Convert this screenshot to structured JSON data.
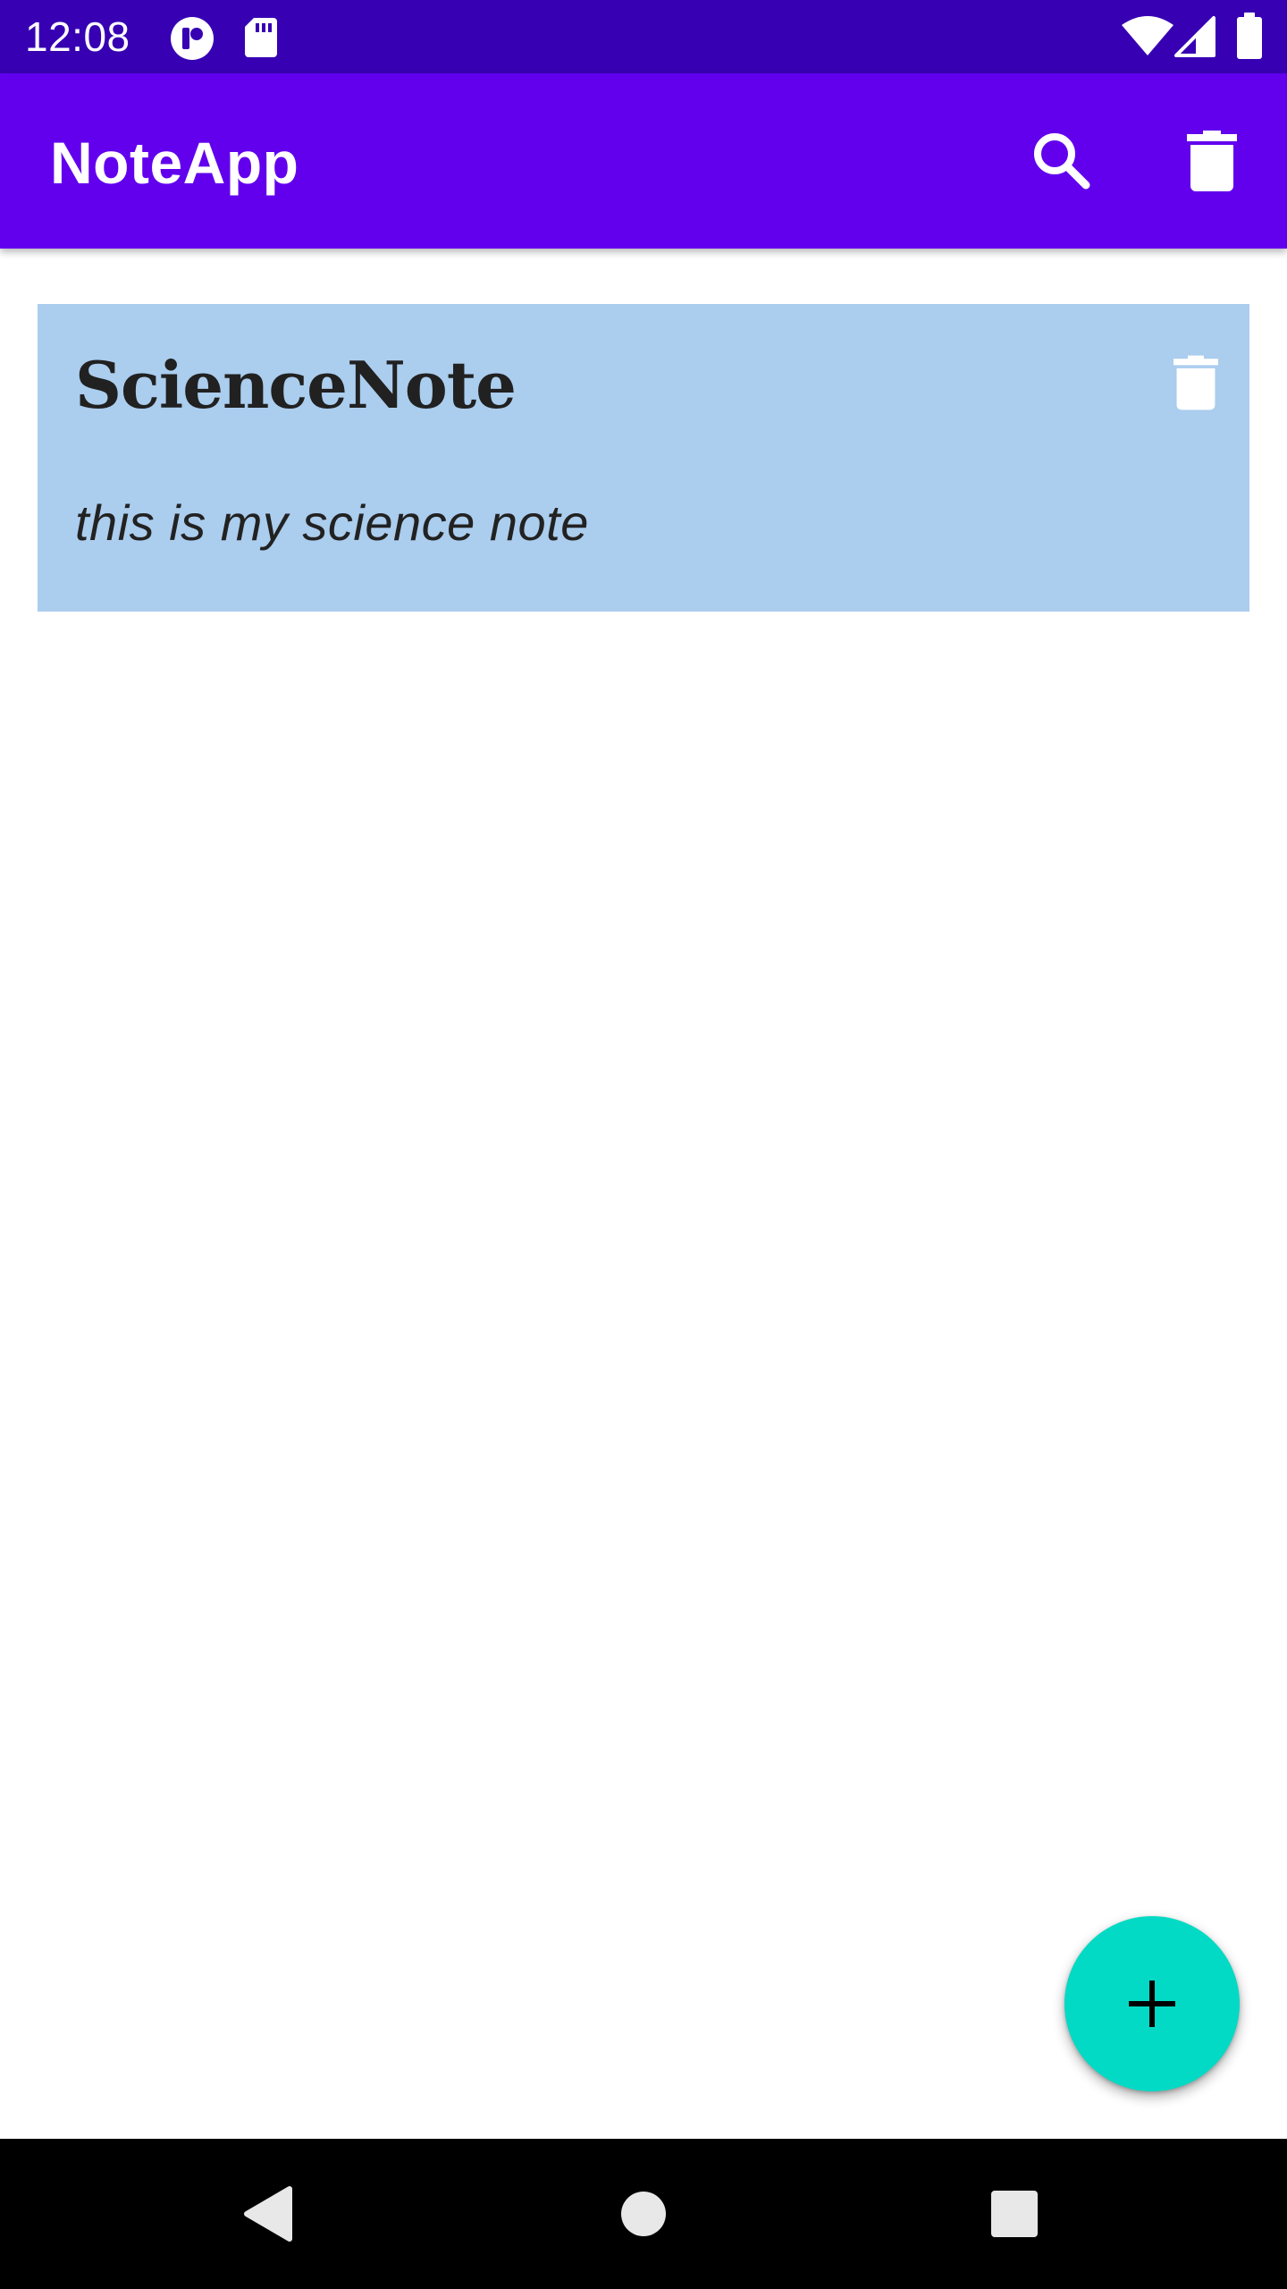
{
  "status_bar": {
    "time": "12:08",
    "icons": [
      "app-notification-icon",
      "sd-card-icon",
      "wifi-icon",
      "cell-signal-icon",
      "battery-icon"
    ]
  },
  "app_bar": {
    "title": "NoteApp",
    "actions": [
      "search-icon",
      "delete-icon"
    ]
  },
  "notes": [
    {
      "title": "ScienceNote",
      "body": "this is my science note",
      "background": "#abcdee"
    }
  ],
  "fab": {
    "icon": "plus-icon"
  },
  "nav_bar": {
    "buttons": [
      "back-icon",
      "home-icon",
      "recents-icon"
    ]
  },
  "colors": {
    "status_bar": "#3700b3",
    "app_bar": "#6200ee",
    "fab": "#03dac5",
    "note_card": "#abcdee"
  }
}
